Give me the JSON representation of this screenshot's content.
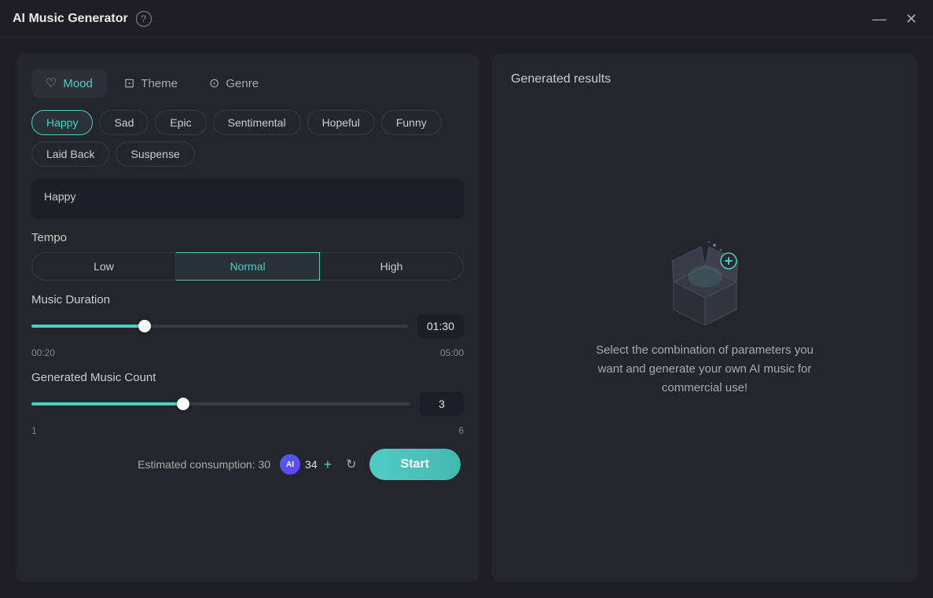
{
  "titlebar": {
    "title": "AI Music Generator",
    "help_label": "?",
    "minimize_label": "—",
    "close_label": "✕"
  },
  "tabs": [
    {
      "id": "mood",
      "label": "Mood",
      "icon": "🎭",
      "active": true
    },
    {
      "id": "theme",
      "label": "Theme",
      "icon": "🖼",
      "active": false
    },
    {
      "id": "genre",
      "label": "Genre",
      "icon": "🎶",
      "active": false
    }
  ],
  "mood": {
    "options": [
      "Happy",
      "Sad",
      "Epic",
      "Sentimental",
      "Hopeful",
      "Funny",
      "Laid Back",
      "Suspense"
    ],
    "selected": "Happy",
    "selected_display": "Happy"
  },
  "tempo": {
    "label": "Tempo",
    "options": [
      "Low",
      "Normal",
      "High"
    ],
    "selected": "Normal"
  },
  "music_duration": {
    "label": "Music Duration",
    "min_label": "00:20",
    "max_label": "05:00",
    "value": "01:30",
    "fill_percent": 30
  },
  "music_count": {
    "label": "Generated Music Count",
    "min_label": "1",
    "max_label": "6",
    "value": "3",
    "fill_percent": 40
  },
  "bottom": {
    "consumption_label": "Estimated consumption: 30",
    "ai_label": "AI",
    "credits": "34",
    "add_icon": "+",
    "refresh_icon": "↻",
    "start_label": "Start"
  },
  "right_panel": {
    "results_label": "Generated results",
    "empty_text": "Select the combination of parameters you want and generate your own AI music for commercial use!"
  }
}
